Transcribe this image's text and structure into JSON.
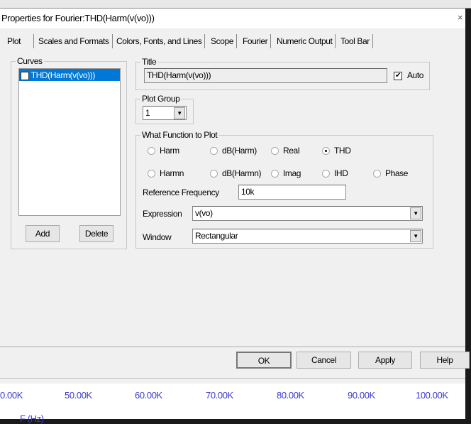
{
  "dialog": {
    "title": "Properties for Fourier:THD(Harm(v(vo)))",
    "close": "×"
  },
  "tabs": [
    "Plot",
    "Scales and Formats",
    "Colors, Fonts, and Lines",
    "Scope",
    "Fourier",
    "Numeric Output",
    "Tool Bar"
  ],
  "curves": {
    "label": "Curves",
    "items": [
      {
        "label": "THD(Harm(v(vo)))",
        "checked": true
      }
    ],
    "add": "Add",
    "delete": "Delete"
  },
  "title_group": {
    "label": "Title",
    "value": "THD(Harm(v(vo)))",
    "auto_label": "Auto",
    "auto_checked": true
  },
  "plot_group": {
    "label": "Plot Group",
    "value": "1"
  },
  "function": {
    "label": "What Function to Plot",
    "options": [
      "Harm",
      "dB(Harm)",
      "Real",
      "THD",
      "Harmn",
      "dB(Harmn)",
      "Imag",
      "IHD",
      "Phase"
    ],
    "selected": "THD",
    "ref_freq_label": "Reference Frequency",
    "ref_freq": "10k",
    "expression_label": "Expression",
    "expression": "v(vo)",
    "window_label": "Window",
    "window": "Rectangular"
  },
  "buttons": {
    "ok": "OK",
    "cancel": "Cancel",
    "apply": "Apply",
    "help": "Help"
  },
  "background_plot": {
    "ticks": [
      "0.00K",
      "50.00K",
      "60.00K",
      "70.00K",
      "80.00K",
      "90.00K",
      "100.00K"
    ],
    "xlabel": "F (Hz)",
    "tick_color": "#3a3ad0"
  }
}
